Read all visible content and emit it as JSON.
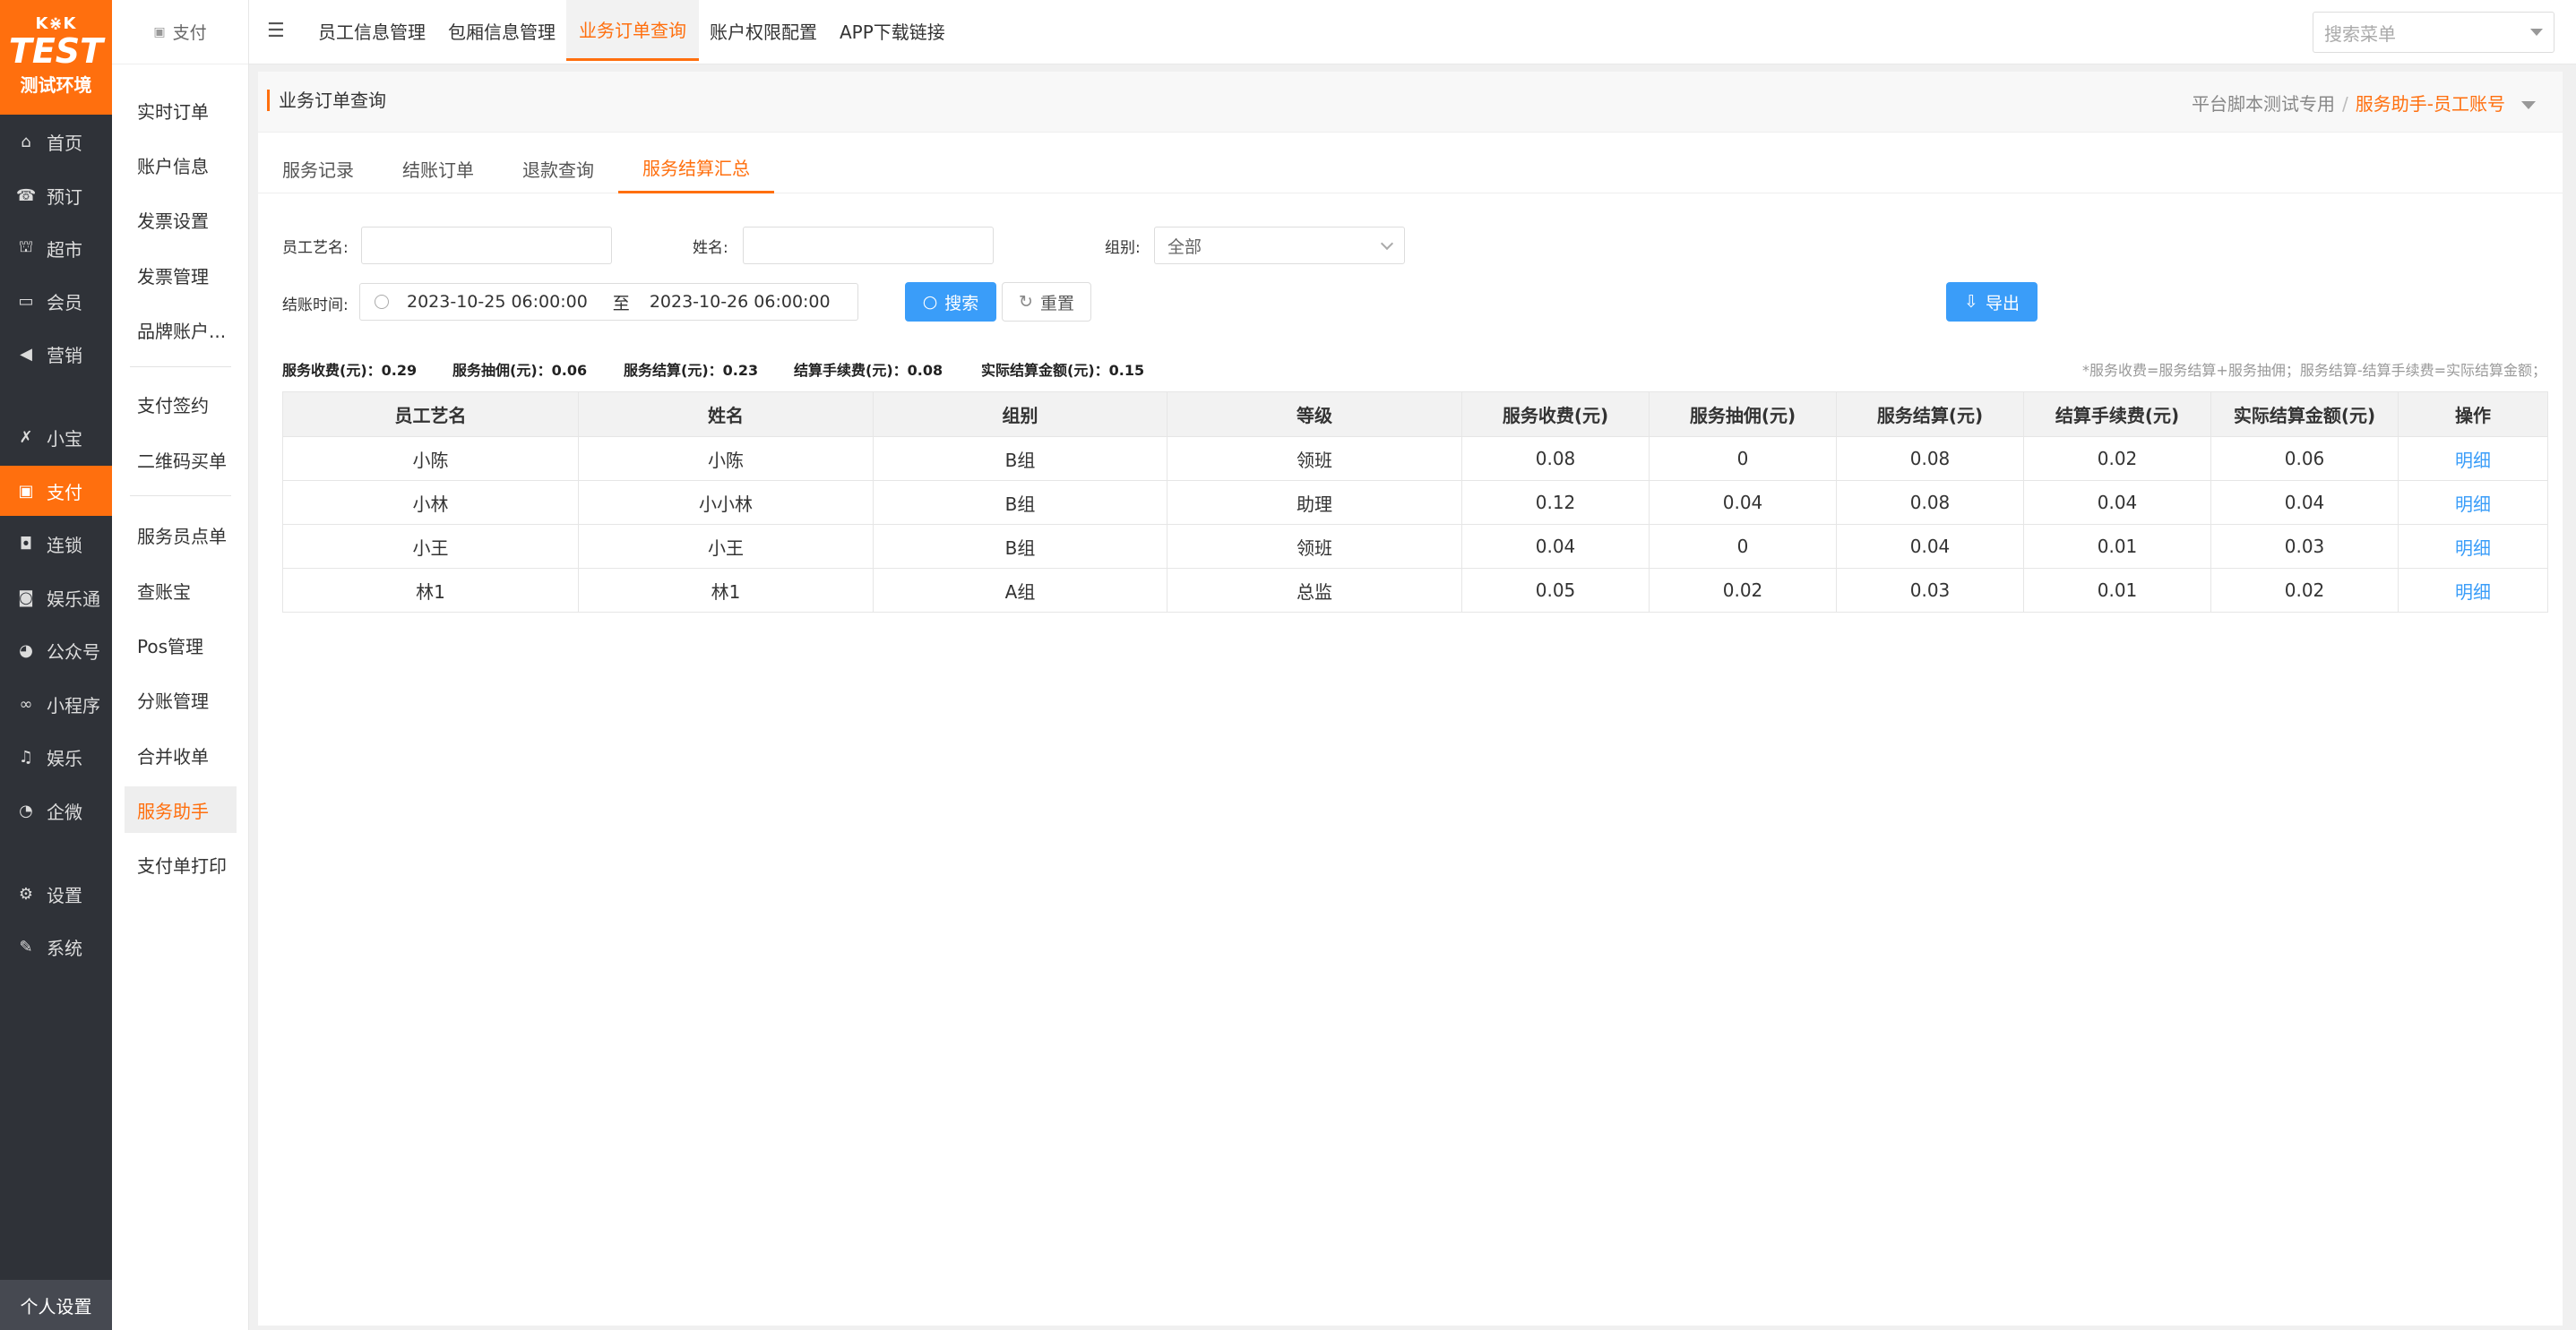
{
  "logo": {
    "brand": "K⋇K",
    "env": "TEST",
    "env_label": "测试环境"
  },
  "leftnav": {
    "items": [
      {
        "label": "首页",
        "icon": "home-icon",
        "glyph": "⌂"
      },
      {
        "label": "预订",
        "icon": "phone-icon",
        "glyph": "☎"
      },
      {
        "label": "超市",
        "icon": "basket-icon",
        "glyph": "⛫"
      },
      {
        "label": "会员",
        "icon": "card-icon",
        "glyph": "▭"
      },
      {
        "label": "营销",
        "icon": "megaphone-icon",
        "glyph": "◀"
      },
      {
        "label": "小宝",
        "icon": "xiaobao-icon",
        "glyph": "✗"
      },
      {
        "label": "支付",
        "icon": "payment-icon",
        "glyph": "▣"
      },
      {
        "label": "连锁",
        "icon": "bag-icon",
        "glyph": "◘"
      },
      {
        "label": "娱乐通",
        "icon": "lock-icon",
        "glyph": "◙"
      },
      {
        "label": "公众号",
        "icon": "wechat-icon",
        "glyph": "◕"
      },
      {
        "label": "小程序",
        "icon": "link-icon",
        "glyph": "∞"
      },
      {
        "label": "娱乐",
        "icon": "music-icon",
        "glyph": "♫"
      },
      {
        "label": "企微",
        "icon": "bell-icon",
        "glyph": "◔"
      },
      {
        "label": "设置",
        "icon": "gears-icon",
        "glyph": "⚙"
      },
      {
        "label": "系统",
        "icon": "wrench-icon",
        "glyph": "✎"
      }
    ],
    "personal_settings": "个人设置"
  },
  "submenu": {
    "head": "支付",
    "items": [
      "实时订单",
      "账户信息",
      "发票设置",
      "发票管理",
      "品牌账户...",
      "支付签约",
      "二维码买单",
      "服务员点单",
      "查账宝",
      "Pos管理",
      "分账管理",
      "合并收单",
      "服务助手",
      "支付单打印"
    ]
  },
  "topbar": {
    "tabs": [
      "员工信息管理",
      "包厢信息管理",
      "业务订单查询",
      "账户权限配置",
      "APP下载链接"
    ],
    "search_placeholder": "搜索菜单"
  },
  "page": {
    "title": "业务订单查询",
    "crumb_parent": "平台脚本测试专用",
    "crumb_sep": "/",
    "crumb_current": "服务助手-员工账号"
  },
  "subtabs": [
    "服务记录",
    "结账订单",
    "退款查询",
    "服务结算汇总"
  ],
  "filters": {
    "artname_label": "员工艺名:",
    "artname_value": "",
    "name_label": "姓名:",
    "name_value": "",
    "group_label": "组别:",
    "group_value": "全部",
    "time_label": "结账时间:",
    "time_start": "2023-10-25 06:00:00",
    "time_to": "至",
    "time_end": "2023-10-26 06:00:00",
    "search_btn": "搜索",
    "reset_btn": "重置",
    "export_btn": "导出"
  },
  "summary": {
    "fee": "服务收费(元)：0.29",
    "commission": "服务抽佣(元)：0.06",
    "settle": "服务结算(元)：0.23",
    "handling": "结算手续费(元)：0.08",
    "actual": "实际结算金额(元)：0.15",
    "formula": "*服务收费=服务结算+服务抽佣；服务结算-结算手续费=实际结算金额；"
  },
  "table": {
    "headers": [
      "员工艺名",
      "姓名",
      "组别",
      "等级",
      "服务收费(元)",
      "服务抽佣(元)",
      "服务结算(元)",
      "结算手续费(元)",
      "实际结算金额(元)",
      "操作"
    ],
    "rows": [
      [
        "小陈",
        "小陈",
        "B组",
        "领班",
        "0.08",
        "0",
        "0.08",
        "0.02",
        "0.06",
        "明细"
      ],
      [
        "小林",
        "小小林",
        "B组",
        "助理",
        "0.12",
        "0.04",
        "0.08",
        "0.04",
        "0.04",
        "明细"
      ],
      [
        "小王",
        "小王",
        "B组",
        "领班",
        "0.04",
        "0",
        "0.04",
        "0.01",
        "0.03",
        "明细"
      ],
      [
        "林1",
        "林1",
        "A组",
        "总监",
        "0.05",
        "0.02",
        "0.03",
        "0.01",
        "0.02",
        "明细"
      ]
    ]
  },
  "colors": {
    "accent": "#ff6f0e",
    "nav_bg": "#2f3238",
    "link": "#3a9df9"
  }
}
